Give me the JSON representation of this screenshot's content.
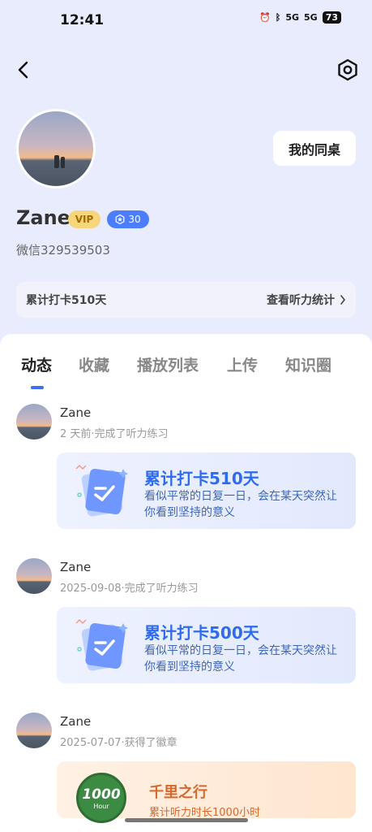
{
  "status": {
    "time": "12:41",
    "battery": "73",
    "signal1": "5G",
    "signal2": "5G"
  },
  "profile": {
    "username": "Zane",
    "vip": "VIP",
    "level": "30",
    "wechat": "微信329539503",
    "desk_button": "我的同桌"
  },
  "stats": {
    "left": "累计打卡510天",
    "right": "查看听力统计"
  },
  "tabs": [
    {
      "label": "动态"
    },
    {
      "label": "收藏"
    },
    {
      "label": "播放列表"
    },
    {
      "label": "上传"
    },
    {
      "label": "知识圈"
    }
  ],
  "feed": [
    {
      "name": "Zane",
      "meta": "2 天前·完成了听力练习",
      "title": "累计打卡510天",
      "subtitle": "看似平常的日复一日，会在某天突然让你看到坚持的意义"
    },
    {
      "name": "Zane",
      "meta": "2025-09-08·完成了听力练习",
      "title": "累计打卡500天",
      "subtitle": "看似平常的日复一日，会在某天突然让你看到坚持的意义"
    },
    {
      "name": "Zane",
      "meta": "2025-07-07·获得了徽章",
      "title": "千里之行",
      "subtitle": "累计听力时长1000小时",
      "medal_num": "1000",
      "medal_unit": "Hour"
    }
  ],
  "colors": {
    "accent": "#3d6df6",
    "card_title": "#2f6bf0",
    "orange": "#d7682b"
  }
}
